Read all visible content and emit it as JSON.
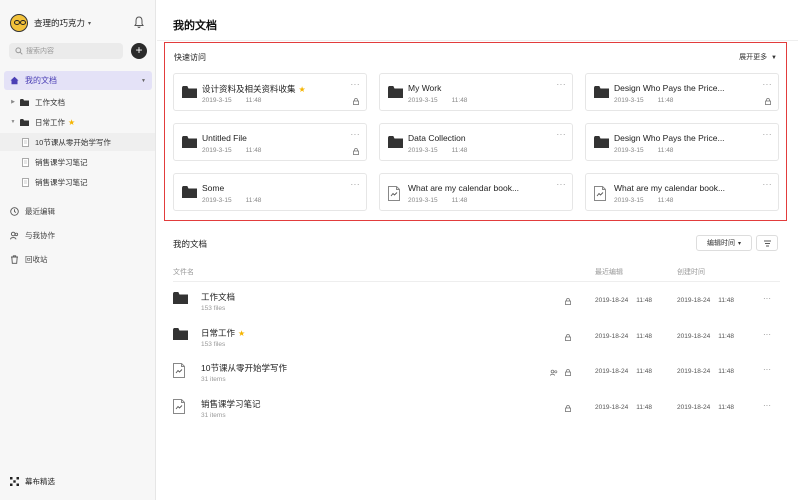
{
  "sidebar": {
    "user_name": "查理的巧克力",
    "user_caret": "▾",
    "search_placeholder": "搜索内容",
    "add_label": "+",
    "my_docs": "我的文档",
    "tree": [
      {
        "label": "工作文档",
        "star": false
      },
      {
        "label": "日常工作",
        "star": true
      },
      {
        "label": "10节课从零开始学写作",
        "star": false
      },
      {
        "label": "销售课学习笔记",
        "star": false
      },
      {
        "label": "销售课学习笔记",
        "star": false
      }
    ],
    "nav": [
      {
        "label": "最近编辑",
        "icon": "clock-icon"
      },
      {
        "label": "与我协作",
        "icon": "collab-icon"
      },
      {
        "label": "回收站",
        "icon": "trash-icon"
      }
    ],
    "footer": "幕布精选"
  },
  "main": {
    "title": "我的文档",
    "quick": {
      "title": "快速访问",
      "expand": "展开更多",
      "cards": [
        {
          "name": "设计资料及相关资料收集",
          "date": "2019-3-15",
          "time": "11:48",
          "type": "folder",
          "star": true,
          "lock": true
        },
        {
          "name": "My Work",
          "date": "2019-3-15",
          "time": "11:48",
          "type": "folder",
          "star": false,
          "lock": false
        },
        {
          "name": "Design Who Pays the Price...",
          "date": "2019-3-15",
          "time": "11:48",
          "type": "folder",
          "star": false,
          "lock": true
        },
        {
          "name": "Untitled File",
          "date": "2019-3-15",
          "time": "11:48",
          "type": "folder",
          "star": false,
          "lock": true
        },
        {
          "name": "Data Collection",
          "date": "2019-3-15",
          "time": "11:48",
          "type": "folder",
          "star": false,
          "lock": false
        },
        {
          "name": "Design Who Pays the Price...",
          "date": "2019-3-15",
          "time": "11:48",
          "type": "folder",
          "star": false,
          "lock": false
        },
        {
          "name": "Some",
          "date": "2019-3-15",
          "time": "11:48",
          "type": "folder",
          "star": false,
          "lock": false
        },
        {
          "name": "What are my calendar book...",
          "date": "2019-3-15",
          "time": "11:48",
          "type": "doc",
          "star": false,
          "lock": false
        },
        {
          "name": "What are my calendar book...",
          "date": "2019-3-15",
          "time": "11:48",
          "type": "doc",
          "star": false,
          "lock": false
        }
      ]
    },
    "list": {
      "title": "我的文档",
      "sort_label": "编辑时间",
      "sort_caret": "▾",
      "headers": {
        "name": "文件名",
        "edited": "最近编辑",
        "created": "创建时间"
      },
      "rows": [
        {
          "name": "工作文档",
          "sub": "153 files",
          "type": "folder",
          "star": false,
          "lock": true,
          "share": false,
          "edited_date": "2019-18-24",
          "edited_time": "11:48",
          "created_date": "2019-18-24",
          "created_time": "11:48"
        },
        {
          "name": "日常工作",
          "sub": "153 files",
          "type": "folder",
          "star": true,
          "lock": true,
          "share": false,
          "edited_date": "2019-18-24",
          "edited_time": "11:48",
          "created_date": "2019-18-24",
          "created_time": "11:48"
        },
        {
          "name": "10节课从零开始学写作",
          "sub": "31 items",
          "type": "doc",
          "star": false,
          "lock": true,
          "share": true,
          "edited_date": "2019-18-24",
          "edited_time": "11:48",
          "created_date": "2019-18-24",
          "created_time": "11:48"
        },
        {
          "name": "销售课学习笔记",
          "sub": "31 items",
          "type": "doc",
          "star": false,
          "lock": true,
          "share": false,
          "edited_date": "2019-18-24",
          "edited_time": "11:48",
          "created_date": "2019-18-24",
          "created_time": "11:48"
        }
      ]
    },
    "more_glyph": "···",
    "star_glyph": "★"
  },
  "colors": {
    "accent": "#4b3fb5",
    "active_bg": "#e4e2f7",
    "star": "#f5b400",
    "highlight_border": "#e23c3c"
  }
}
